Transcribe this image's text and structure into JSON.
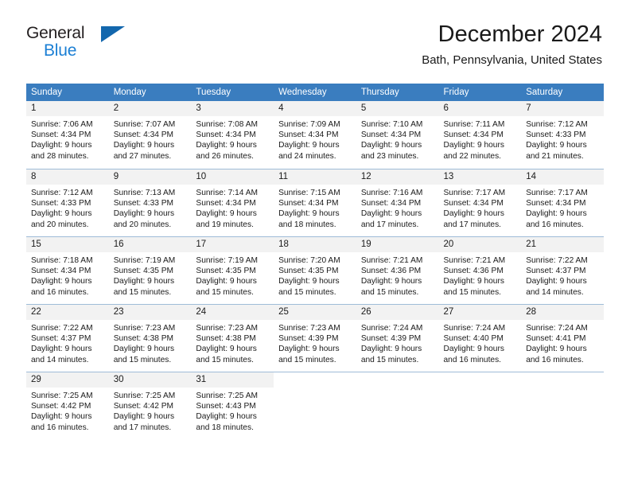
{
  "brand": {
    "name_top": "General",
    "name_bottom": "Blue",
    "flag_icon": "triangle-flag-icon",
    "color_dark": "#231f20",
    "color_blue": "#1b7fd4",
    "color_flag": "#1367ad"
  },
  "header": {
    "title": "December 2024",
    "subtitle": "Bath, Pennsylvania, United States"
  },
  "colors": {
    "header_row_bg": "#3a7dbf",
    "header_row_text": "#ffffff",
    "daynum_bg": "#f2f2f2",
    "grid_line": "#9fbcd8",
    "text": "#1a1a1a"
  },
  "weekdays": [
    "Sunday",
    "Monday",
    "Tuesday",
    "Wednesday",
    "Thursday",
    "Friday",
    "Saturday"
  ],
  "weeks": [
    [
      {
        "day": "1",
        "sunrise": "Sunrise: 7:06 AM",
        "sunset": "Sunset: 4:34 PM",
        "daylight1": "Daylight: 9 hours",
        "daylight2": "and 28 minutes."
      },
      {
        "day": "2",
        "sunrise": "Sunrise: 7:07 AM",
        "sunset": "Sunset: 4:34 PM",
        "daylight1": "Daylight: 9 hours",
        "daylight2": "and 27 minutes."
      },
      {
        "day": "3",
        "sunrise": "Sunrise: 7:08 AM",
        "sunset": "Sunset: 4:34 PM",
        "daylight1": "Daylight: 9 hours",
        "daylight2": "and 26 minutes."
      },
      {
        "day": "4",
        "sunrise": "Sunrise: 7:09 AM",
        "sunset": "Sunset: 4:34 PM",
        "daylight1": "Daylight: 9 hours",
        "daylight2": "and 24 minutes."
      },
      {
        "day": "5",
        "sunrise": "Sunrise: 7:10 AM",
        "sunset": "Sunset: 4:34 PM",
        "daylight1": "Daylight: 9 hours",
        "daylight2": "and 23 minutes."
      },
      {
        "day": "6",
        "sunrise": "Sunrise: 7:11 AM",
        "sunset": "Sunset: 4:34 PM",
        "daylight1": "Daylight: 9 hours",
        "daylight2": "and 22 minutes."
      },
      {
        "day": "7",
        "sunrise": "Sunrise: 7:12 AM",
        "sunset": "Sunset: 4:33 PM",
        "daylight1": "Daylight: 9 hours",
        "daylight2": "and 21 minutes."
      }
    ],
    [
      {
        "day": "8",
        "sunrise": "Sunrise: 7:12 AM",
        "sunset": "Sunset: 4:33 PM",
        "daylight1": "Daylight: 9 hours",
        "daylight2": "and 20 minutes."
      },
      {
        "day": "9",
        "sunrise": "Sunrise: 7:13 AM",
        "sunset": "Sunset: 4:33 PM",
        "daylight1": "Daylight: 9 hours",
        "daylight2": "and 20 minutes."
      },
      {
        "day": "10",
        "sunrise": "Sunrise: 7:14 AM",
        "sunset": "Sunset: 4:34 PM",
        "daylight1": "Daylight: 9 hours",
        "daylight2": "and 19 minutes."
      },
      {
        "day": "11",
        "sunrise": "Sunrise: 7:15 AM",
        "sunset": "Sunset: 4:34 PM",
        "daylight1": "Daylight: 9 hours",
        "daylight2": "and 18 minutes."
      },
      {
        "day": "12",
        "sunrise": "Sunrise: 7:16 AM",
        "sunset": "Sunset: 4:34 PM",
        "daylight1": "Daylight: 9 hours",
        "daylight2": "and 17 minutes."
      },
      {
        "day": "13",
        "sunrise": "Sunrise: 7:17 AM",
        "sunset": "Sunset: 4:34 PM",
        "daylight1": "Daylight: 9 hours",
        "daylight2": "and 17 minutes."
      },
      {
        "day": "14",
        "sunrise": "Sunrise: 7:17 AM",
        "sunset": "Sunset: 4:34 PM",
        "daylight1": "Daylight: 9 hours",
        "daylight2": "and 16 minutes."
      }
    ],
    [
      {
        "day": "15",
        "sunrise": "Sunrise: 7:18 AM",
        "sunset": "Sunset: 4:34 PM",
        "daylight1": "Daylight: 9 hours",
        "daylight2": "and 16 minutes."
      },
      {
        "day": "16",
        "sunrise": "Sunrise: 7:19 AM",
        "sunset": "Sunset: 4:35 PM",
        "daylight1": "Daylight: 9 hours",
        "daylight2": "and 15 minutes."
      },
      {
        "day": "17",
        "sunrise": "Sunrise: 7:19 AM",
        "sunset": "Sunset: 4:35 PM",
        "daylight1": "Daylight: 9 hours",
        "daylight2": "and 15 minutes."
      },
      {
        "day": "18",
        "sunrise": "Sunrise: 7:20 AM",
        "sunset": "Sunset: 4:35 PM",
        "daylight1": "Daylight: 9 hours",
        "daylight2": "and 15 minutes."
      },
      {
        "day": "19",
        "sunrise": "Sunrise: 7:21 AM",
        "sunset": "Sunset: 4:36 PM",
        "daylight1": "Daylight: 9 hours",
        "daylight2": "and 15 minutes."
      },
      {
        "day": "20",
        "sunrise": "Sunrise: 7:21 AM",
        "sunset": "Sunset: 4:36 PM",
        "daylight1": "Daylight: 9 hours",
        "daylight2": "and 15 minutes."
      },
      {
        "day": "21",
        "sunrise": "Sunrise: 7:22 AM",
        "sunset": "Sunset: 4:37 PM",
        "daylight1": "Daylight: 9 hours",
        "daylight2": "and 14 minutes."
      }
    ],
    [
      {
        "day": "22",
        "sunrise": "Sunrise: 7:22 AM",
        "sunset": "Sunset: 4:37 PM",
        "daylight1": "Daylight: 9 hours",
        "daylight2": "and 14 minutes."
      },
      {
        "day": "23",
        "sunrise": "Sunrise: 7:23 AM",
        "sunset": "Sunset: 4:38 PM",
        "daylight1": "Daylight: 9 hours",
        "daylight2": "and 15 minutes."
      },
      {
        "day": "24",
        "sunrise": "Sunrise: 7:23 AM",
        "sunset": "Sunset: 4:38 PM",
        "daylight1": "Daylight: 9 hours",
        "daylight2": "and 15 minutes."
      },
      {
        "day": "25",
        "sunrise": "Sunrise: 7:23 AM",
        "sunset": "Sunset: 4:39 PM",
        "daylight1": "Daylight: 9 hours",
        "daylight2": "and 15 minutes."
      },
      {
        "day": "26",
        "sunrise": "Sunrise: 7:24 AM",
        "sunset": "Sunset: 4:39 PM",
        "daylight1": "Daylight: 9 hours",
        "daylight2": "and 15 minutes."
      },
      {
        "day": "27",
        "sunrise": "Sunrise: 7:24 AM",
        "sunset": "Sunset: 4:40 PM",
        "daylight1": "Daylight: 9 hours",
        "daylight2": "and 16 minutes."
      },
      {
        "day": "28",
        "sunrise": "Sunrise: 7:24 AM",
        "sunset": "Sunset: 4:41 PM",
        "daylight1": "Daylight: 9 hours",
        "daylight2": "and 16 minutes."
      }
    ],
    [
      {
        "day": "29",
        "sunrise": "Sunrise: 7:25 AM",
        "sunset": "Sunset: 4:42 PM",
        "daylight1": "Daylight: 9 hours",
        "daylight2": "and 16 minutes."
      },
      {
        "day": "30",
        "sunrise": "Sunrise: 7:25 AM",
        "sunset": "Sunset: 4:42 PM",
        "daylight1": "Daylight: 9 hours",
        "daylight2": "and 17 minutes."
      },
      {
        "day": "31",
        "sunrise": "Sunrise: 7:25 AM",
        "sunset": "Sunset: 4:43 PM",
        "daylight1": "Daylight: 9 hours",
        "daylight2": "and 18 minutes."
      },
      {
        "day": "",
        "sunrise": "",
        "sunset": "",
        "daylight1": "",
        "daylight2": ""
      },
      {
        "day": "",
        "sunrise": "",
        "sunset": "",
        "daylight1": "",
        "daylight2": ""
      },
      {
        "day": "",
        "sunrise": "",
        "sunset": "",
        "daylight1": "",
        "daylight2": ""
      },
      {
        "day": "",
        "sunrise": "",
        "sunset": "",
        "daylight1": "",
        "daylight2": ""
      }
    ]
  ]
}
